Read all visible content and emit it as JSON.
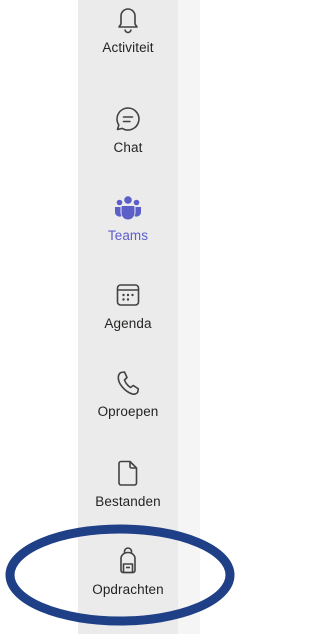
{
  "sidebar": {
    "items": [
      {
        "id": "activity",
        "label": "Activiteit",
        "icon": "bell-icon",
        "active": false
      },
      {
        "id": "chat",
        "label": "Chat",
        "icon": "chat-bubble-icon",
        "active": false
      },
      {
        "id": "teams",
        "label": "Teams",
        "icon": "teams-people-icon",
        "active": true
      },
      {
        "id": "calendar",
        "label": "Agenda",
        "icon": "calendar-icon",
        "active": false
      },
      {
        "id": "calls",
        "label": "Oproepen",
        "icon": "phone-icon",
        "active": false
      },
      {
        "id": "files",
        "label": "Bestanden",
        "icon": "file-icon",
        "active": false
      },
      {
        "id": "assignments",
        "label": "Opdrachten",
        "icon": "backpack-icon",
        "active": false
      }
    ]
  },
  "colors": {
    "rail_bg": "#ebebeb",
    "active": "#5b5fc7",
    "icon": "#424242",
    "label": "#252423",
    "annotation": "#1f3f86"
  }
}
